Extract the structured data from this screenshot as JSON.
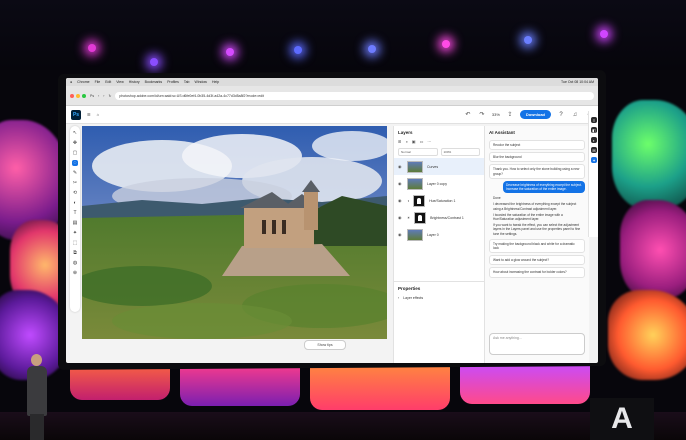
{
  "menubar": {
    "items": [
      "",
      "Chrome",
      "File",
      "Edit",
      "View",
      "History",
      "Bookmarks",
      "Profiles",
      "Tab",
      "Window",
      "Help"
    ],
    "clock": "Tue Oct 08 10:04 AM"
  },
  "browser": {
    "tab_title": "Ps",
    "url": "photoshop.adobe.com/id/urn:aaid:sc:US:d6fe0ef4-0b35-4d3f-a42a-4c77d3d5a8f2?mode=edit"
  },
  "appbar": {
    "doc_title": "Ps",
    "zoom": "33%",
    "download_label": "Download"
  },
  "toolbar": {
    "tools": [
      "↖",
      "✥",
      "▢",
      "◌",
      "✎",
      "✂",
      "⟲",
      "◐",
      "T",
      "▤",
      "✦",
      "⬚",
      "⧉",
      "◍",
      "⊕"
    ]
  },
  "canvas": {
    "photo_button": "Show tips"
  },
  "layers": {
    "title": "Layers",
    "blend_mode": "Normal",
    "opacity": "100%",
    "rows": [
      {
        "name": "Curves",
        "selected": true
      },
      {
        "name": "Layer 0 copy",
        "selected": false
      },
      {
        "name": "Hue/Saturation 1",
        "selected": false
      },
      {
        "name": "Brightness/Contrast 1",
        "selected": false
      },
      {
        "name": "Layer 0",
        "selected": false
      }
    ]
  },
  "properties": {
    "title": "Properties",
    "row": "Layer effects"
  },
  "assistant": {
    "title": "AI Assistant",
    "messages": [
      {
        "kind": "suggest",
        "text": "Recolor the subject"
      },
      {
        "kind": "suggest",
        "text": "Blur the background"
      },
      {
        "kind": "suggest",
        "text": "Thank you. How to select only the stone building using a new group?"
      },
      {
        "kind": "user",
        "text": "Decrease brightness of everything except the subject. Increase the saturation of the entire image."
      },
      {
        "kind": "step",
        "text": "Done"
      },
      {
        "kind": "step",
        "text": "I decreased the brightness of everything except the subject using a Brightness/Contrast adjustment layer."
      },
      {
        "kind": "step",
        "text": "I boosted the saturation of the entire image with a Hue/Saturation adjustment layer."
      },
      {
        "kind": "step",
        "text": "If you want to tweak the effect, you can select the adjustment layers in the Layers panel and use the properties panel to fine tune the settings."
      },
      {
        "kind": "suggest",
        "text": "Try making the background black and white for a dramatic look"
      },
      {
        "kind": "suggest",
        "text": "Want to add a glow around the subject?"
      },
      {
        "kind": "suggest",
        "text": "How about increasing the contrast for bolder colors?"
      }
    ],
    "input_placeholder": "Ask me anything..."
  },
  "colors": {
    "accent": "#1473e6",
    "ps_badge_bg": "#001e36",
    "ps_badge_fg": "#31a8ff"
  }
}
